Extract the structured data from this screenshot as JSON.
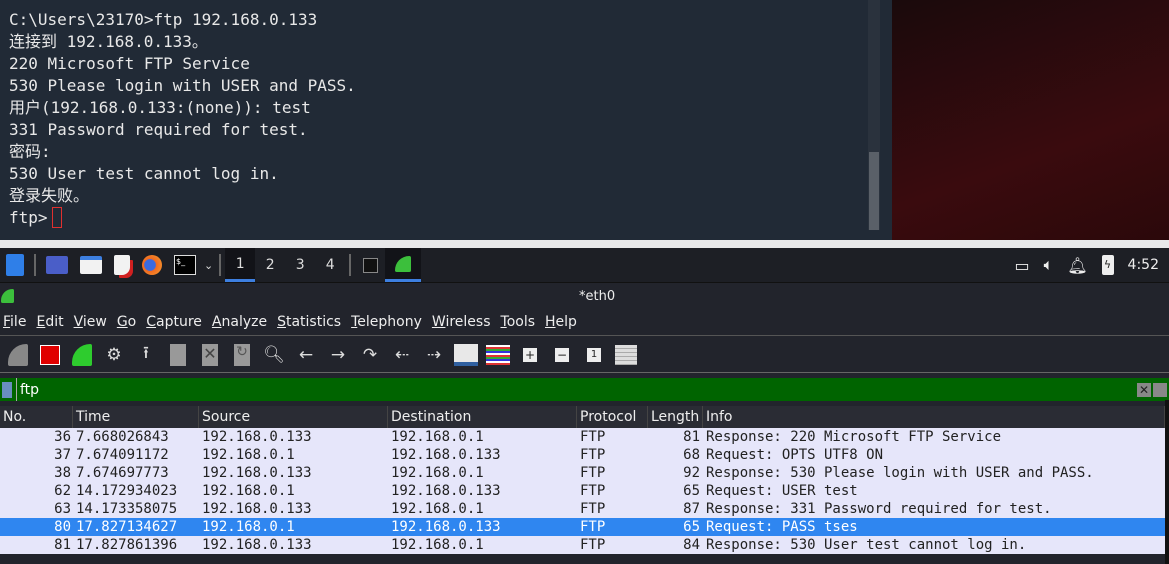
{
  "terminal": {
    "lines": [
      "C:\\Users\\23170>ftp 192.168.0.133",
      "连接到 192.168.0.133。",
      "220 Microsoft FTP Service",
      "530 Please login with USER and PASS.",
      "用户(192.168.0.133:(none)): test",
      "331 Password required for test.",
      "密码:",
      "530 User test cannot log in.",
      "登录失败。"
    ],
    "prompt": "ftp>"
  },
  "taskbar": {
    "workspaces": [
      "1",
      "2",
      "3",
      "4"
    ],
    "active_workspace": "1",
    "clock": "4:52",
    "icons": [
      "kali-menu-icon",
      "desktop-icon",
      "file-manager-icon",
      "text-editor-icon",
      "firefox-icon",
      "terminal-icon",
      "chevron-down-icon",
      "terminal-window-icon",
      "wireshark-window-icon"
    ],
    "tray": [
      "display-icon",
      "volume-icon",
      "bell-icon",
      "battery-icon"
    ]
  },
  "window": {
    "title": "*eth0"
  },
  "menu": [
    "File",
    "Edit",
    "View",
    "Go",
    "Capture",
    "Analyze",
    "Statistics",
    "Telephony",
    "Wireless",
    "Tools",
    "Help"
  ],
  "filter": {
    "value": "ftp",
    "color": "#006400"
  },
  "columns": [
    "No.",
    "Time",
    "Source",
    "Destination",
    "Protocol",
    "Length",
    "Info"
  ],
  "packets": [
    [
      "36",
      "7.668026843",
      "192.168.0.133",
      "192.168.0.1",
      "FTP",
      "81",
      "Response: 220 Microsoft FTP Service"
    ],
    [
      "37",
      "7.674091172",
      "192.168.0.1",
      "192.168.0.133",
      "FTP",
      "68",
      "Request: OPTS UTF8 ON"
    ],
    [
      "38",
      "7.674697773",
      "192.168.0.133",
      "192.168.0.1",
      "FTP",
      "92",
      "Response: 530 Please login with USER and PASS."
    ],
    [
      "62",
      "14.172934023",
      "192.168.0.1",
      "192.168.0.133",
      "FTP",
      "65",
      "Request: USER test"
    ],
    [
      "63",
      "14.173358075",
      "192.168.0.133",
      "192.168.0.1",
      "FTP",
      "87",
      "Response: 331 Password required for test."
    ],
    [
      "80",
      "17.827134627",
      "192.168.0.1",
      "192.168.0.133",
      "FTP",
      "65",
      "Request: PASS tses"
    ],
    [
      "81",
      "17.827861396",
      "192.168.0.133",
      "192.168.0.1",
      "FTP",
      "84",
      "Response: 530 User test cannot log in."
    ]
  ],
  "selected_packet": "80"
}
